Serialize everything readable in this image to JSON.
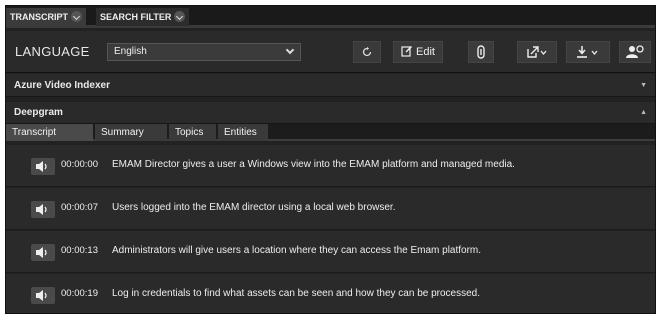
{
  "top_tabs": [
    {
      "label": "TRANSCRIPT",
      "icon": "chevron-down-icon"
    },
    {
      "label": "SEARCH FILTER",
      "icon": "chevron-down-icon"
    }
  ],
  "language_bar": {
    "label": "LANGUAGE",
    "selected": "English",
    "edit_label": "Edit"
  },
  "providers": [
    {
      "name": "Azure Video Indexer",
      "state_icon": "caret-down-icon"
    },
    {
      "name": "Deepgram",
      "state_icon": "caret-up-icon"
    }
  ],
  "sub_tabs": [
    {
      "label": "Transcript",
      "active": true
    },
    {
      "label": "Summary",
      "active": false
    },
    {
      "label": "Topics",
      "active": false
    },
    {
      "label": "Entities",
      "active": false
    }
  ],
  "transcript": [
    {
      "time": "00:00:00",
      "text": "EMAM Director gives a user a Windows view into the EMAM platform and managed media."
    },
    {
      "time": "00:00:07",
      "text": "Users logged into the EMAM director using a local web browser."
    },
    {
      "time": "00:00:13",
      "text": "Administrators will give users a location where they can access the Emam platform."
    },
    {
      "time": "00:00:19",
      "text": "Log in credentials to find what assets can be seen and how they can be processed."
    }
  ],
  "colors": {
    "panel": "#2a2a2a",
    "background": "#222222",
    "tab_active": "#4a4a4a"
  }
}
